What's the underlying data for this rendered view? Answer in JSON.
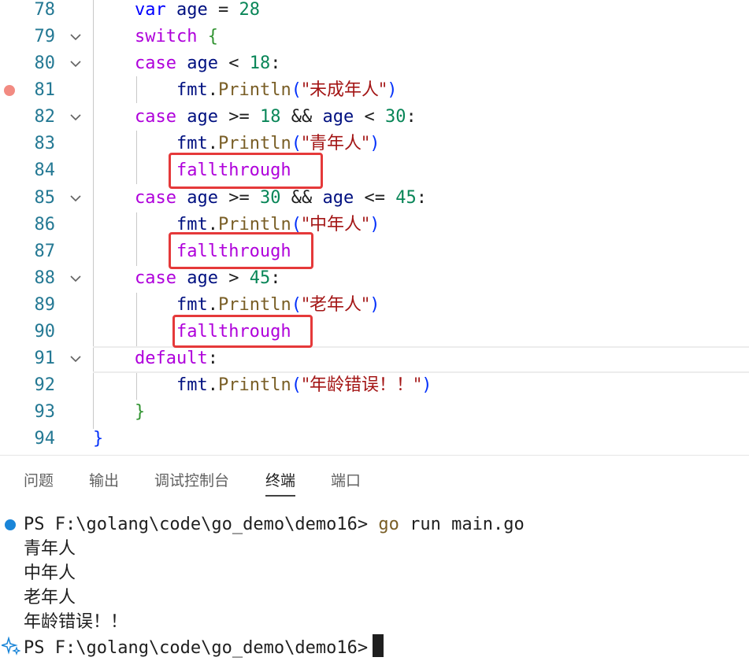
{
  "editor": {
    "lines": [
      {
        "num": "78",
        "code": "var age = 28"
      },
      {
        "num": "79",
        "code": "switch {"
      },
      {
        "num": "80",
        "code": "case age < 18:"
      },
      {
        "num": "81",
        "code": "fmt.Println(\"未成年人\")"
      },
      {
        "num": "82",
        "code": "case age >= 18 && age < 30:"
      },
      {
        "num": "83",
        "code": "fmt.Println(\"青年人\")"
      },
      {
        "num": "84",
        "code": "fallthrough"
      },
      {
        "num": "85",
        "code": "case age >= 30 && age <= 45:"
      },
      {
        "num": "86",
        "code": "fmt.Println(\"中年人\")"
      },
      {
        "num": "87",
        "code": "fallthrough"
      },
      {
        "num": "88",
        "code": "case age > 45:"
      },
      {
        "num": "89",
        "code": "fmt.Println(\"老年人\")"
      },
      {
        "num": "90",
        "code": "fallthrough"
      },
      {
        "num": "91",
        "code": "default:"
      },
      {
        "num": "92",
        "code": "fmt.Println(\"年龄错误！！\")"
      },
      {
        "num": "93",
        "code": "}"
      },
      {
        "num": "94",
        "code": "}"
      }
    ],
    "tokens": {
      "var": "var",
      "age": "age",
      "eq": "=",
      "n28": "28",
      "switch": "switch",
      "lbrace": "{",
      "case": "case",
      "lt": "<",
      "n18": "18",
      "colon": ":",
      "fmt": "fmt",
      "dot": ".",
      "println": "Println",
      "lparen": "(",
      "rparen": ")",
      "s81": "\"未成年人\"",
      "ge": ">=",
      "and": "&&",
      "n30": "30",
      "s83": "\"青年人\"",
      "fallthrough": "fallthrough",
      "le": "<=",
      "n45": "45",
      "s86": "\"中年人\"",
      "gt": ">",
      "s89": "\"老年人\"",
      "default": "default",
      "s92": "\"年龄错误！！\"",
      "rbrace": "}"
    },
    "breakpoint_line": "81",
    "colors": {
      "keyword": "#af00db",
      "number": "#098658",
      "string": "#a31515",
      "function": "#795e26",
      "highlight_box": "#e5393a"
    }
  },
  "panel": {
    "tabs": [
      {
        "label": "问题"
      },
      {
        "label": "输出"
      },
      {
        "label": "调试控制台"
      },
      {
        "label": "终端"
      },
      {
        "label": "端口"
      }
    ],
    "active_tab": "终端"
  },
  "terminal": {
    "prompt": "PS F:\\golang\\code\\go_demo\\demo16>",
    "command_go": "go",
    "command_rest": "run main.go",
    "output": [
      "青年人",
      "中年人",
      "老年人",
      "年龄错误！！"
    ],
    "prompt2": "PS F:\\golang\\code\\go_demo\\demo16>"
  }
}
